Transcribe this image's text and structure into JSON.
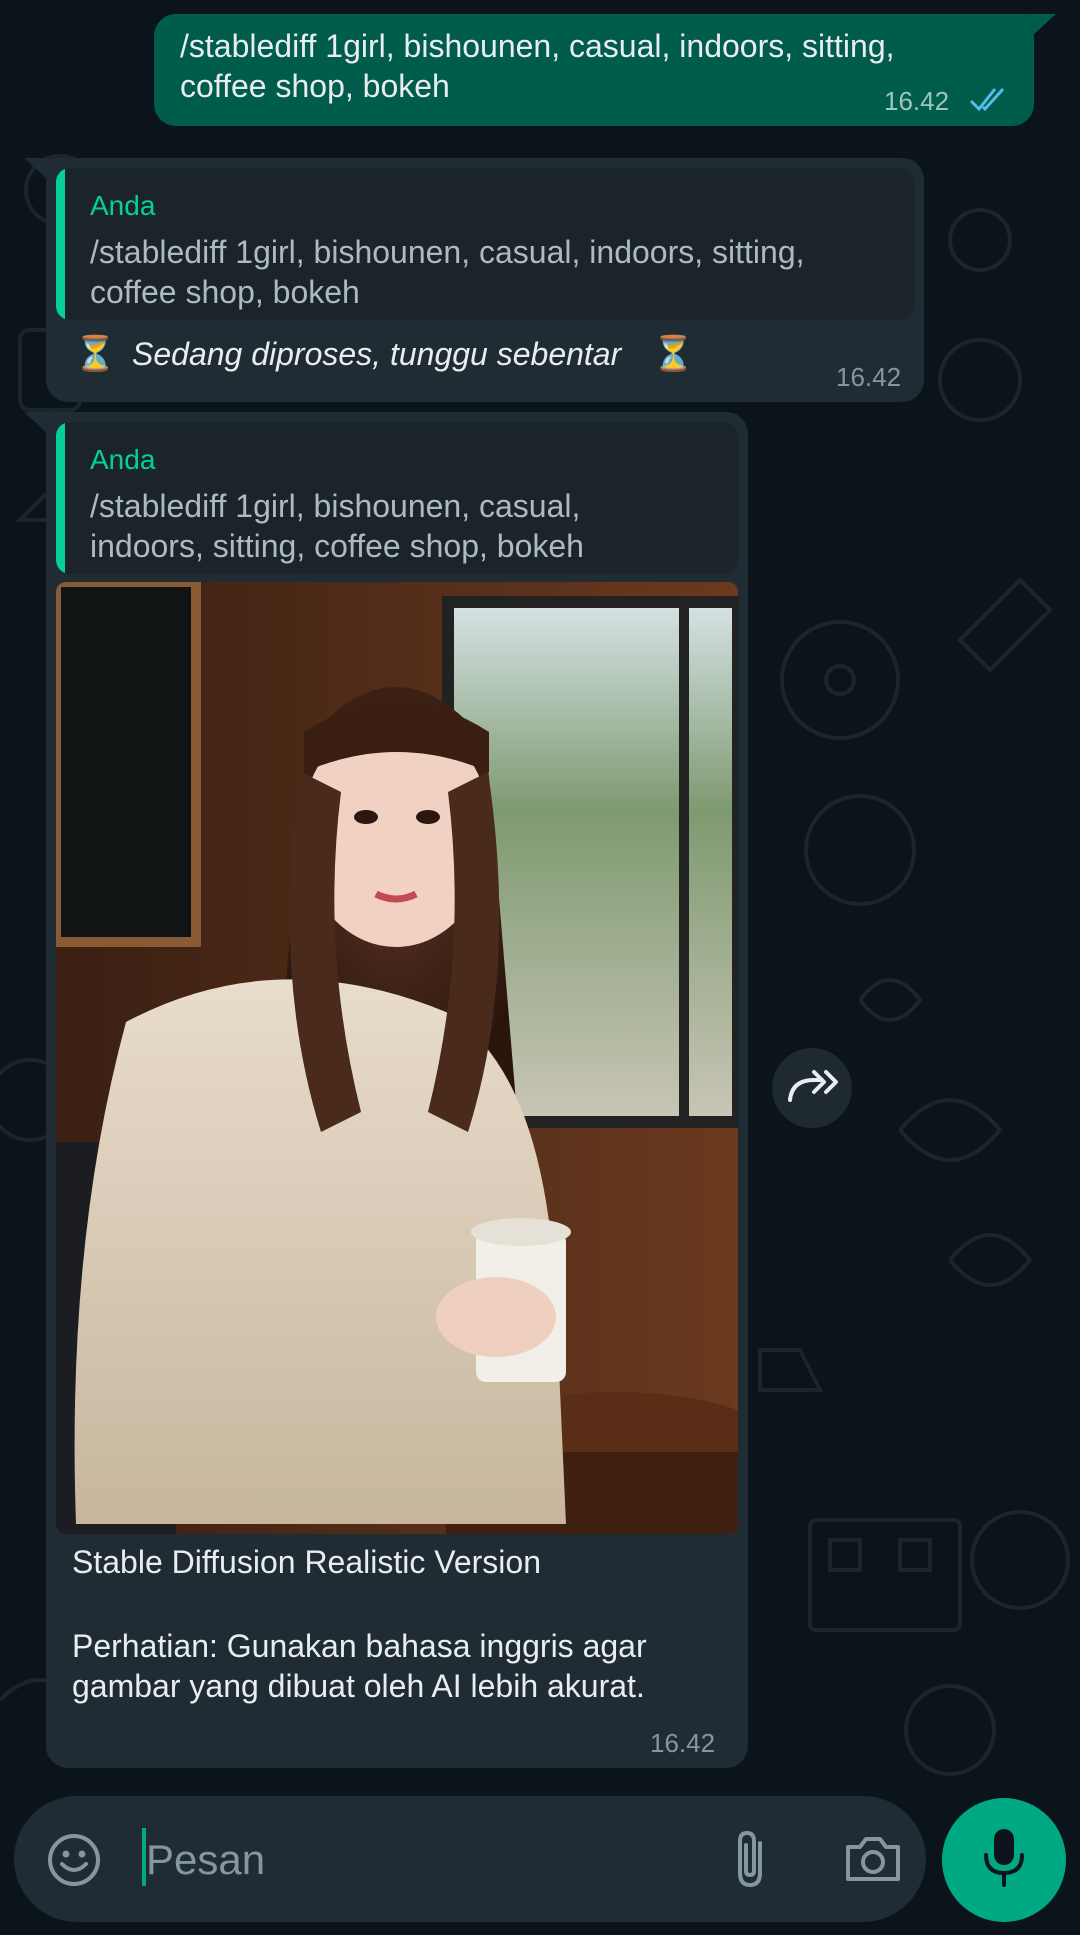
{
  "messages": {
    "sent": {
      "text": "/stablediff 1girl, bishounen, casual, indoors, sitting,\ncoffee shop, bokeh",
      "time": "16.42",
      "status_icon": "double-check-read-icon"
    },
    "reply_processing": {
      "quote_author": "Anda",
      "quote_text": "/stablediff 1girl, bishounen, casual, indoors, sitting,\ncoffee shop, bokeh",
      "hourglass_left": "⏳",
      "text": "Sedang diproses, tunggu sebentar",
      "hourglass_right": "⏳",
      "time": "16.42"
    },
    "reply_image": {
      "quote_author": "Anda",
      "quote_text": "/stablediff 1girl, bishounen, casual,\nindoors, sitting, coffee shop, bokeh",
      "image_description_icon": "generated-photo",
      "caption_title": "Stable Diffusion Realistic Version",
      "caption_note": "Perhatian: Gunakan bahasa inggris agar\ngambar yang dibuat oleh AI lebih akurat.",
      "time": "16.42"
    }
  },
  "input": {
    "placeholder": "Pesan",
    "emoji_icon": "emoji-icon",
    "attach_icon": "paperclip-icon",
    "camera_icon": "camera-icon",
    "mic_icon": "microphone-icon"
  },
  "colors": {
    "background": "#0b141a",
    "outgoing_bubble": "#005c4b",
    "incoming_bubble": "#202c33",
    "accent": "#00a884",
    "quote_author": "#06cf9c",
    "read_tick": "#53bdeb"
  }
}
